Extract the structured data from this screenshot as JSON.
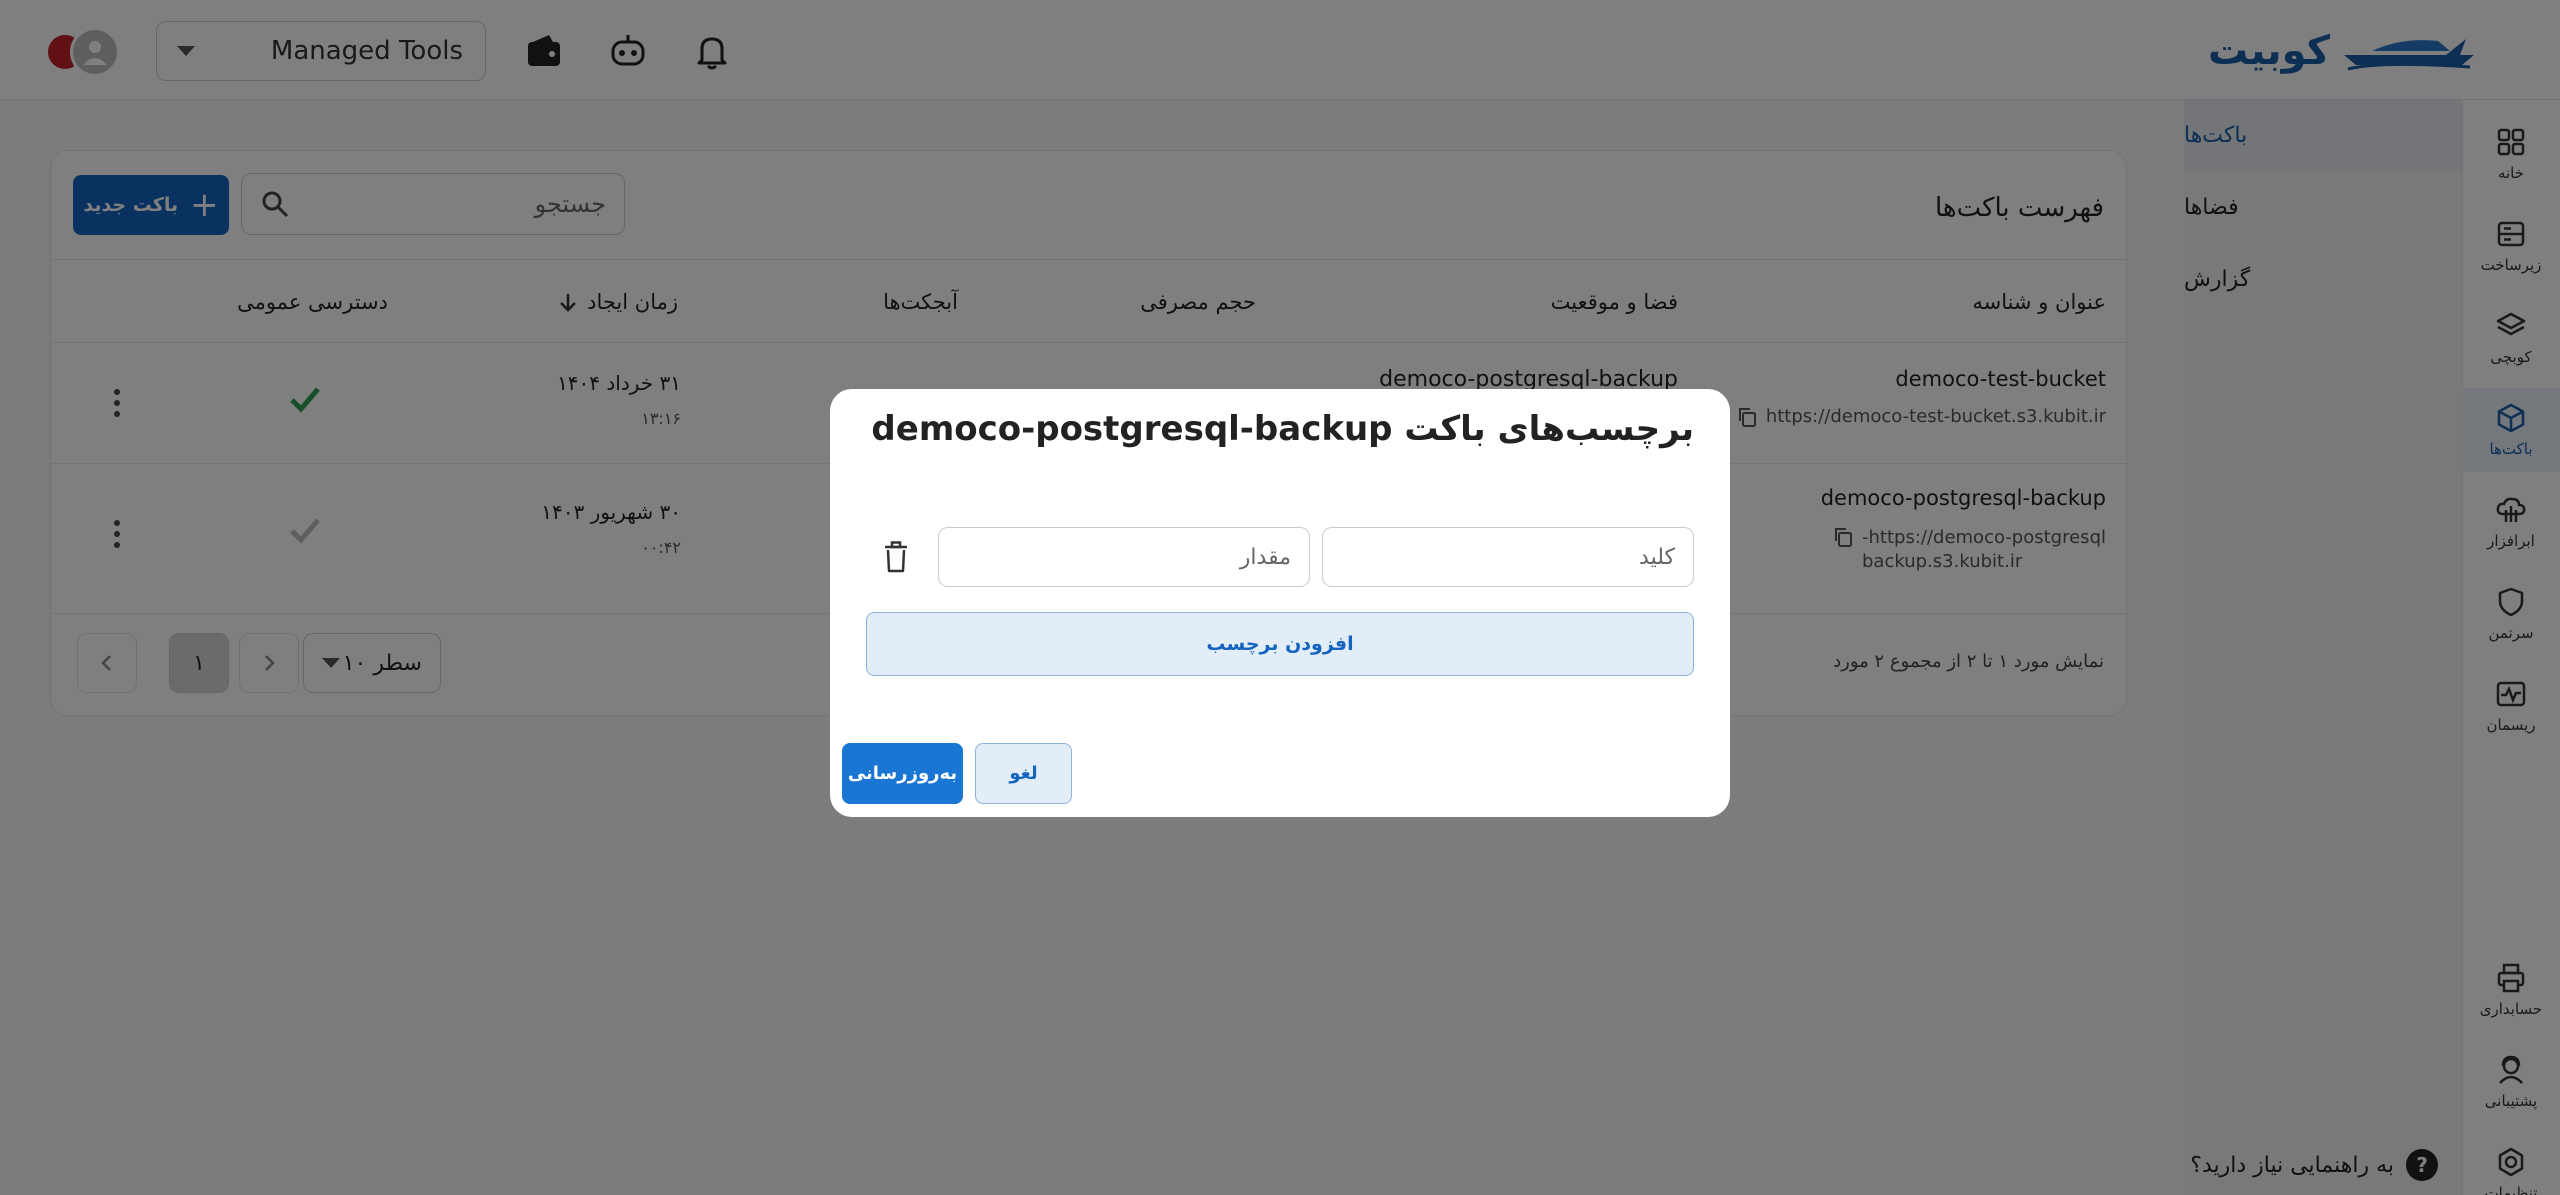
{
  "brand": {
    "logo_text": "کوبیت"
  },
  "header": {
    "project_select_value": "Managed Tools",
    "icons": [
      "wallet-icon",
      "bot-icon",
      "bell-icon"
    ]
  },
  "rail": {
    "items": [
      {
        "label": "خانه",
        "icon": "grid-icon"
      },
      {
        "label": "زیرساخت",
        "icon": "server-icon"
      },
      {
        "label": "کوبچی",
        "icon": "layers-icon"
      },
      {
        "label": "باکت‌ها",
        "icon": "cube-icon",
        "active": true
      },
      {
        "label": "ابرافزار",
        "icon": "cloud-tree-icon"
      },
      {
        "label": "سرتمن",
        "icon": "shield-icon"
      },
      {
        "label": "ریسمان",
        "icon": "monitor-pulse-icon"
      },
      {
        "label": "حسابداری",
        "icon": "printer-icon"
      },
      {
        "label": "پشتیبانی",
        "icon": "support-icon"
      },
      {
        "label": "تنظیمات",
        "icon": "gear-icon"
      }
    ]
  },
  "subnav": {
    "items": [
      {
        "label": "باکت‌ها",
        "active": true
      },
      {
        "label": "فضاها"
      },
      {
        "label": "گزارش"
      }
    ],
    "help_text": "به راهنمایی نیاز دارید؟",
    "help_glyph": "?"
  },
  "card": {
    "title": "فهرست باکت‌ها",
    "new_button_label": "باکت جدید",
    "search_placeholder": "جستجو",
    "columns": {
      "name": "عنوان و شناسه",
      "space": "فضا و موقعیت",
      "size": "حجم مصرفی",
      "objects": "آبجکت‌ها",
      "created": "زمان ایجاد",
      "public": "دسترسی عمومی"
    },
    "rows": [
      {
        "name": "democo-test-bucket",
        "url_line1": "https://democo-test-bucket.s3.kubit.ir",
        "url_line2": "",
        "space_partial": "democo-postgresql-backup",
        "date": "۳۱ خرداد ۱۴۰۴",
        "time": "۱۳:۱۶",
        "public": true
      },
      {
        "name": "democo-postgresql-backup",
        "url_line1": "https://democo-postgresql-",
        "url_line2": "backup.s3.kubit.ir",
        "date": "۳۰ شهریور ۱۴۰۳",
        "time": "۰۰:۴۲",
        "public": false
      }
    ],
    "footer_info": "نمایش مورد ۱ تا ۲ از مجموع ۲ مورد",
    "rows_per_page": "۱۰ سطر",
    "current_page": "۱"
  },
  "modal": {
    "title": "برچسب‌های باکت democo-postgresql-backup",
    "key_placeholder": "کلید",
    "value_placeholder": "مقدار",
    "add_tag_label": "افزودن برچسب",
    "cancel_label": "لغو",
    "update_label": "به‌روزرسانی"
  },
  "colors": {
    "primary": "#1565c0",
    "brand": "#1a5ea8",
    "check_green": "#2e9e4f",
    "overlay": "rgba(0,0,0,0.5)"
  }
}
